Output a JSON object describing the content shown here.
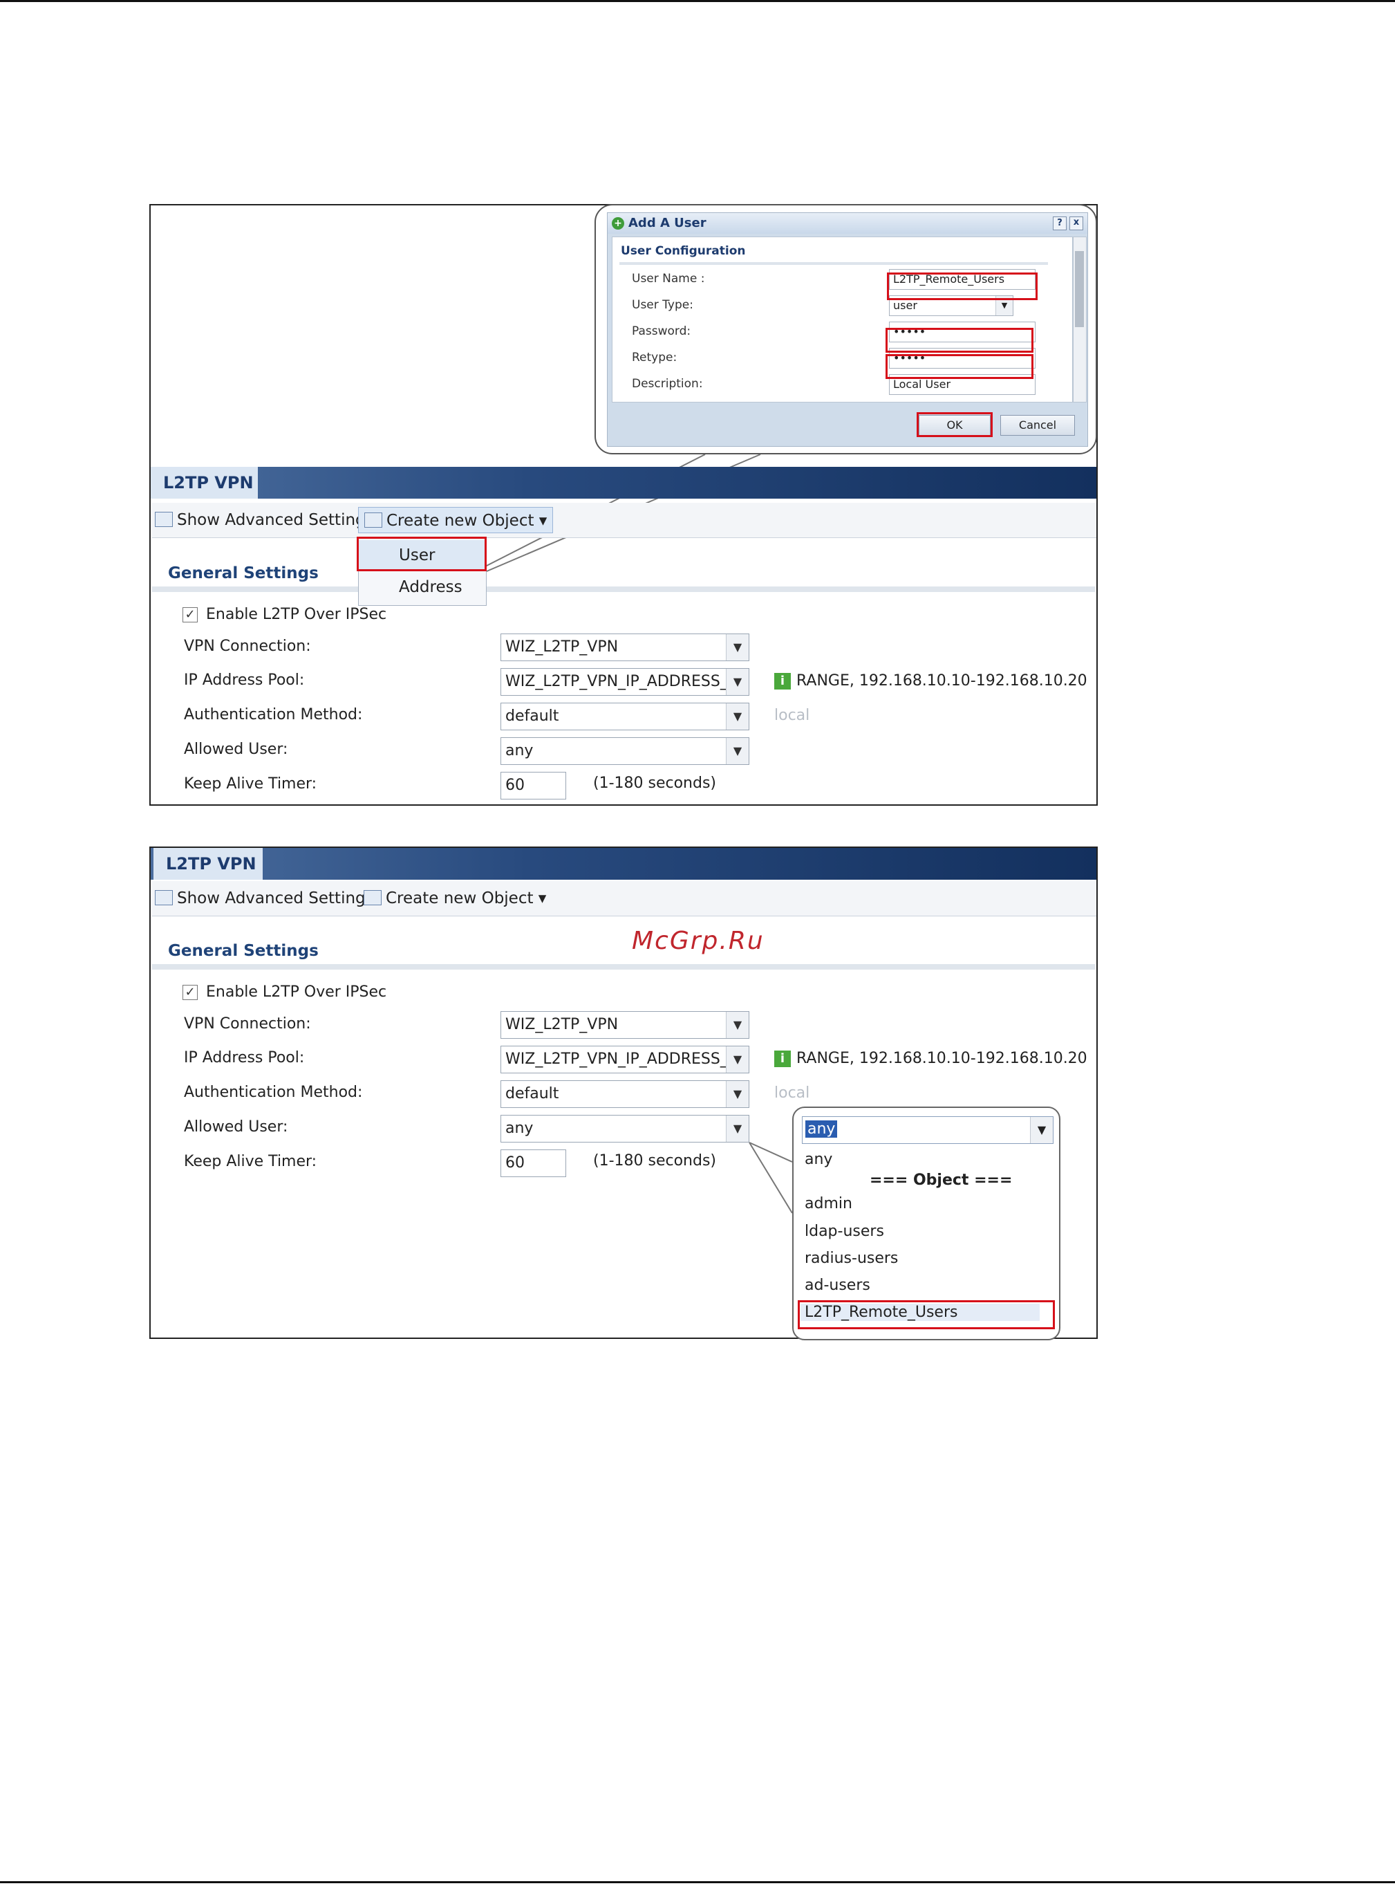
{
  "watermark": "McGrp.Ru",
  "dialog": {
    "title": "Add A User",
    "help_btn": "?",
    "close_btn": "x",
    "section": "User Configuration",
    "user_name_label": "User Name :",
    "user_name_value": "L2TP_Remote_Users",
    "user_type_label": "User Type:",
    "user_type_value": "user",
    "password_label": "Password:",
    "password_value": "•••••",
    "retype_label": "Retype:",
    "retype_value": "•••••",
    "description_label": "Description:",
    "description_value": "Local User",
    "ok_label": "OK",
    "cancel_label": "Cancel"
  },
  "panel1": {
    "tab_title": "L2TP VPN",
    "show_advanced": "Show Advanced Settings",
    "create_new": "Create new Object",
    "menu_items": [
      "User",
      "Address"
    ],
    "section_title": "General Settings",
    "enable_label": "Enable L2TP Over IPSec",
    "vpn_connection_label": "VPN Connection:",
    "vpn_connection_value": "WIZ_L2TP_VPN",
    "ip_pool_label": "IP Address Pool:",
    "ip_pool_value": "WIZ_L2TP_VPN_IP_ADDRESS_",
    "range_info": "RANGE, 192.168.10.10-192.168.10.20",
    "auth_label": "Authentication Method:",
    "auth_value": "default",
    "auth_hint": "local",
    "allowed_user_label": "Allowed User:",
    "allowed_user_value": "any",
    "keepalive_label": "Keep Alive Timer:",
    "keepalive_value": "60",
    "keepalive_hint": "(1-180 seconds)"
  },
  "panel2": {
    "tab_title": "L2TP VPN",
    "show_advanced": "Show Advanced Settings",
    "create_new": "Create new Object",
    "section_title": "General Settings",
    "enable_label": "Enable L2TP Over IPSec",
    "vpn_connection_label": "VPN Connection:",
    "vpn_connection_value": "WIZ_L2TP_VPN",
    "ip_pool_label": "IP Address Pool:",
    "ip_pool_value": "WIZ_L2TP_VPN_IP_ADDRESS_",
    "range_info": "RANGE, 192.168.10.10-192.168.10.20",
    "auth_label": "Authentication Method:",
    "auth_value": "default",
    "auth_hint": "local",
    "allowed_user_label": "Allowed User:",
    "allowed_user_value": "any",
    "keepalive_label": "Keep Alive Timer:",
    "keepalive_value": "60",
    "keepalive_hint": "(1-180 seconds)",
    "dropdown_selected": "any",
    "dropdown_options": [
      "any",
      "=== Object ===",
      "admin",
      "ldap-users",
      "radius-users",
      "ad-users",
      "L2TP_Remote_Users"
    ]
  },
  "colors": {
    "accent": "#1f4378",
    "highlight": "#d6101a",
    "titlebar": "#13305e"
  }
}
